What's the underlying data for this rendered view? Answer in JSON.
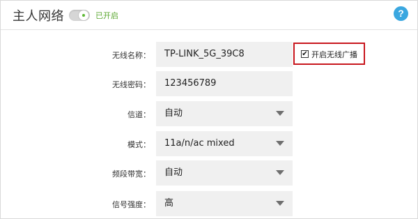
{
  "header": {
    "title": "主人网络",
    "toggle_status": "已开启",
    "help_label": "?"
  },
  "form": {
    "ssid": {
      "label": "无线名称：",
      "value": "TP-LINK_5G_39C8"
    },
    "password": {
      "label": "无线密码：",
      "value": "123456789"
    },
    "channel": {
      "label": "信道：",
      "value": "自动"
    },
    "mode": {
      "label": "模式：",
      "value": "11a/n/ac mixed"
    },
    "bandwidth": {
      "label": "频段带宽：",
      "value": "自动"
    },
    "tx_power": {
      "label": "信号强度：",
      "value": "高"
    },
    "broadcast": {
      "label": "开启无线广播",
      "checked": true,
      "check_glyph": "✔"
    }
  },
  "colors": {
    "accent_green": "#5ca832",
    "help_blue": "#3aa7e0",
    "highlight_red": "#c8161d",
    "field_bg": "#f0f0f0"
  }
}
